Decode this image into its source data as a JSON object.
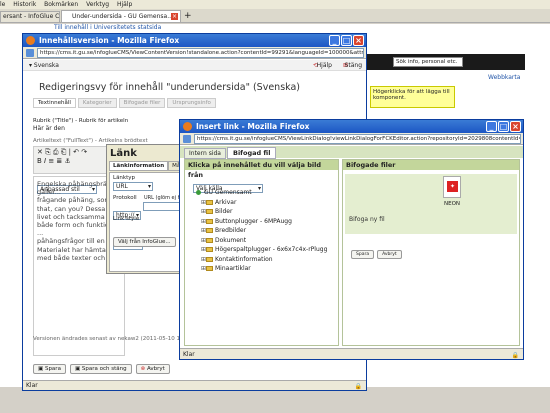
{
  "browser_bg": {
    "menu": [
      "le",
      "Historik",
      "Bokmärken",
      "Verktyg",
      "Hjälp"
    ],
    "tab1": "ersant - InfoGlue C",
    "tab2": "Under-undersida - GU Gemensa...",
    "notice": "Till innehåll i Universitetets statsida",
    "right_link": "Webbkarta",
    "search_placeholder": "Sök info, personal etc.",
    "tooltip": "Högerklicka för att lägga till komponent",
    "highlight_note": "Högerklicka för att lägga till komponent."
  },
  "win1": {
    "title": "Innehållsversion - Mozilla Firefox",
    "url": "https://cms.it.gu.se/infoglueCMS/ViewContentVersion!standalone.action?contentId=99291&languageId=100000&attributeName=Full",
    "lang": "Svenska",
    "help": "Hjälp",
    "close": "Stäng",
    "heading": "Redigeringsvy för innehåll \"underundersida\" (Svenska)",
    "tabs": [
      "Textinnehåll",
      "Kategorier",
      "Bifogade filer",
      "Ursprungsinfo"
    ],
    "rubrik_label": "Rubrik (\"Title\") - Rubrik för artikeln",
    "rubrik_value": "Här är den",
    "artikeltext_label": "Artikeltext (\"FullText\") - Artikelns brödtext",
    "format": "Anpassad stil",
    "body_text": [
      "Engelska påhängsbrägd gäller...",
      "frågande påhäng, som ...",
      "that, can you? Dessa ...",
      "livet och tacksamma ...",
      "både form och funktion ...",
      "påhängsfrågor till en f...",
      "Materialet har hämtats ...",
      "med både texter och ..."
    ],
    "footer_note": "Versionen ändrades senast av nekaw2 (2011-05-10 11:14)",
    "save": "Spara",
    "save_close": "Spara och stäng",
    "cancel": "Avbryt",
    "status": "Klar"
  },
  "link_dialog": {
    "title": "Länk",
    "tabs": [
      "Länkinformation",
      "Mål",
      "Le"
    ],
    "linktype_label": "Länktyp",
    "linktype": "URL",
    "protocol_label": "Protokoll",
    "protocol": "http://",
    "url_label": "URL (glöm ej http://)",
    "linkstyle_label": "Link style",
    "linkstyle": "Pdf",
    "choose_btn": "Välj från InfoGlue..."
  },
  "win2": {
    "title": "Insert link - Mozilla Firefox",
    "url": "https://cms.it.gu.se/infoglueCMS/ViewLinkDialog!viewLinkDialogForFCKEditor.action?repositoryId=2029808contentId=99291&language",
    "tab_internal": "Intern sida",
    "tab_attached": "Bifogad fil",
    "left_header": "Klicka på innehållet du vill välja bild från",
    "source": "Välj källa",
    "tree_root": "GU Gemensamt",
    "tree_items": [
      "Arkivar",
      "Bilder",
      "Buttonplugger - 6MPAugg",
      "Bredbilder",
      "Dokument",
      "Högerspaltplugger - 6x6x7c4x-rPlugg",
      "Kontaktinformation",
      "Minaartiklar"
    ],
    "right_header": "Bifogade filer",
    "file_name": "NEON",
    "file_link": "Bifoga ny fil",
    "btn_choose": "Spara",
    "btn_cancel": "Avbryt",
    "status": "Klar"
  }
}
